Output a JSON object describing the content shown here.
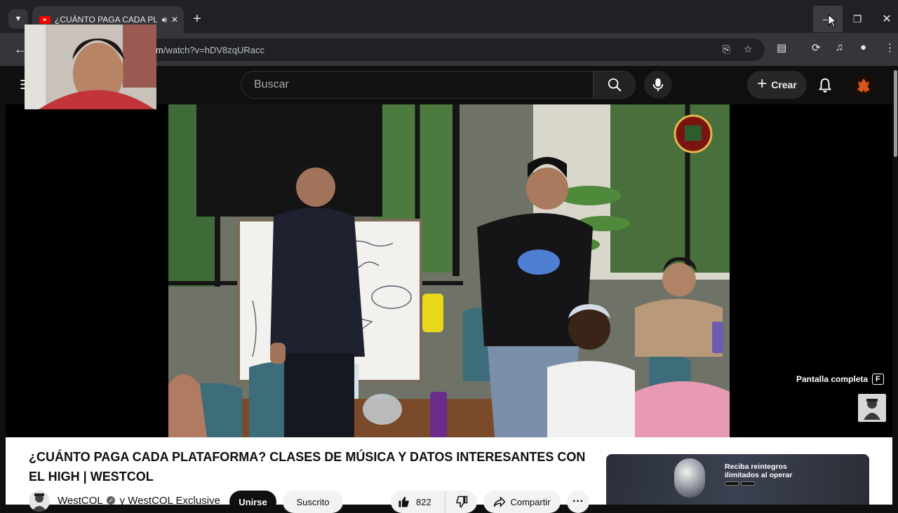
{
  "browser": {
    "tab_title": "¿CUÁNTO PAGA CADA PLATAFORMA? CLASES DE MÚSICA Y DATOS INTERESANTES CON EL HIGH | WESTCOL - YouTube",
    "url": "m/watch?v=hDV8zqURacc",
    "url_domain": "m",
    "url_path": "/watch?v=hDV8zqURacc"
  },
  "masthead": {
    "search_placeholder": "Buscar",
    "create_label": "Crear"
  },
  "player": {
    "fullscreen_tip": "Pantalla completa",
    "fullscreen_key": "F"
  },
  "video": {
    "title": "¿CUÁNTO PAGA CADA PLATAFORMA? CLASES DE MÚSICA Y DATOS INTERESANTES CON EL HIGH | WESTCOL",
    "channel_name": "WestCOL",
    "channel_joiner": "y",
    "collab_name": "WestCOL Exclusive",
    "join_label": "Unirse",
    "subscribed_label": "Suscrito",
    "like_count": "822",
    "share_label": "Compartir"
  },
  "ad": {
    "headline": "Reciba reintegros ilimitados al operar"
  },
  "colors": {
    "youtube_red": "#ff0000",
    "background_dark": "#0f0f0f",
    "chrome_dark": "#202124"
  }
}
